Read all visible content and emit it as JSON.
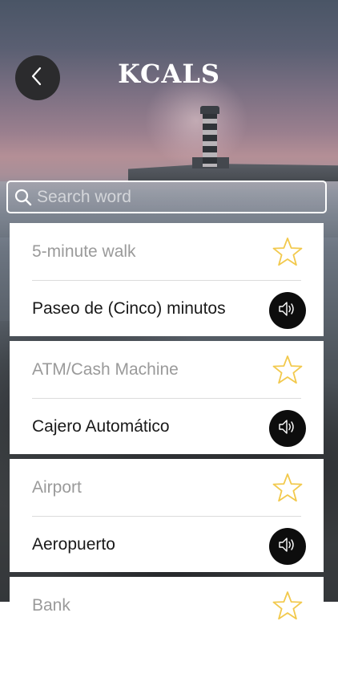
{
  "header": {
    "title": "KCALS",
    "back_icon": "chevron-left-icon"
  },
  "search": {
    "placeholder": "Search word",
    "value": "",
    "icon": "search-icon"
  },
  "colors": {
    "star": "#f2c94c",
    "speaker_bg": "#0d0d0d",
    "card_bg": "#ffffff",
    "english_text": "#9a9a9a",
    "spanish_text": "#1a1a1a"
  },
  "entries": [
    {
      "english": "5-minute walk",
      "spanish": "Paseo de (Cinco) minutos"
    },
    {
      "english": "ATM/Cash Machine",
      "spanish": "Cajero Automático"
    },
    {
      "english": "Airport",
      "spanish": "Aeropuerto"
    },
    {
      "english": "Bank",
      "spanish": ""
    }
  ]
}
